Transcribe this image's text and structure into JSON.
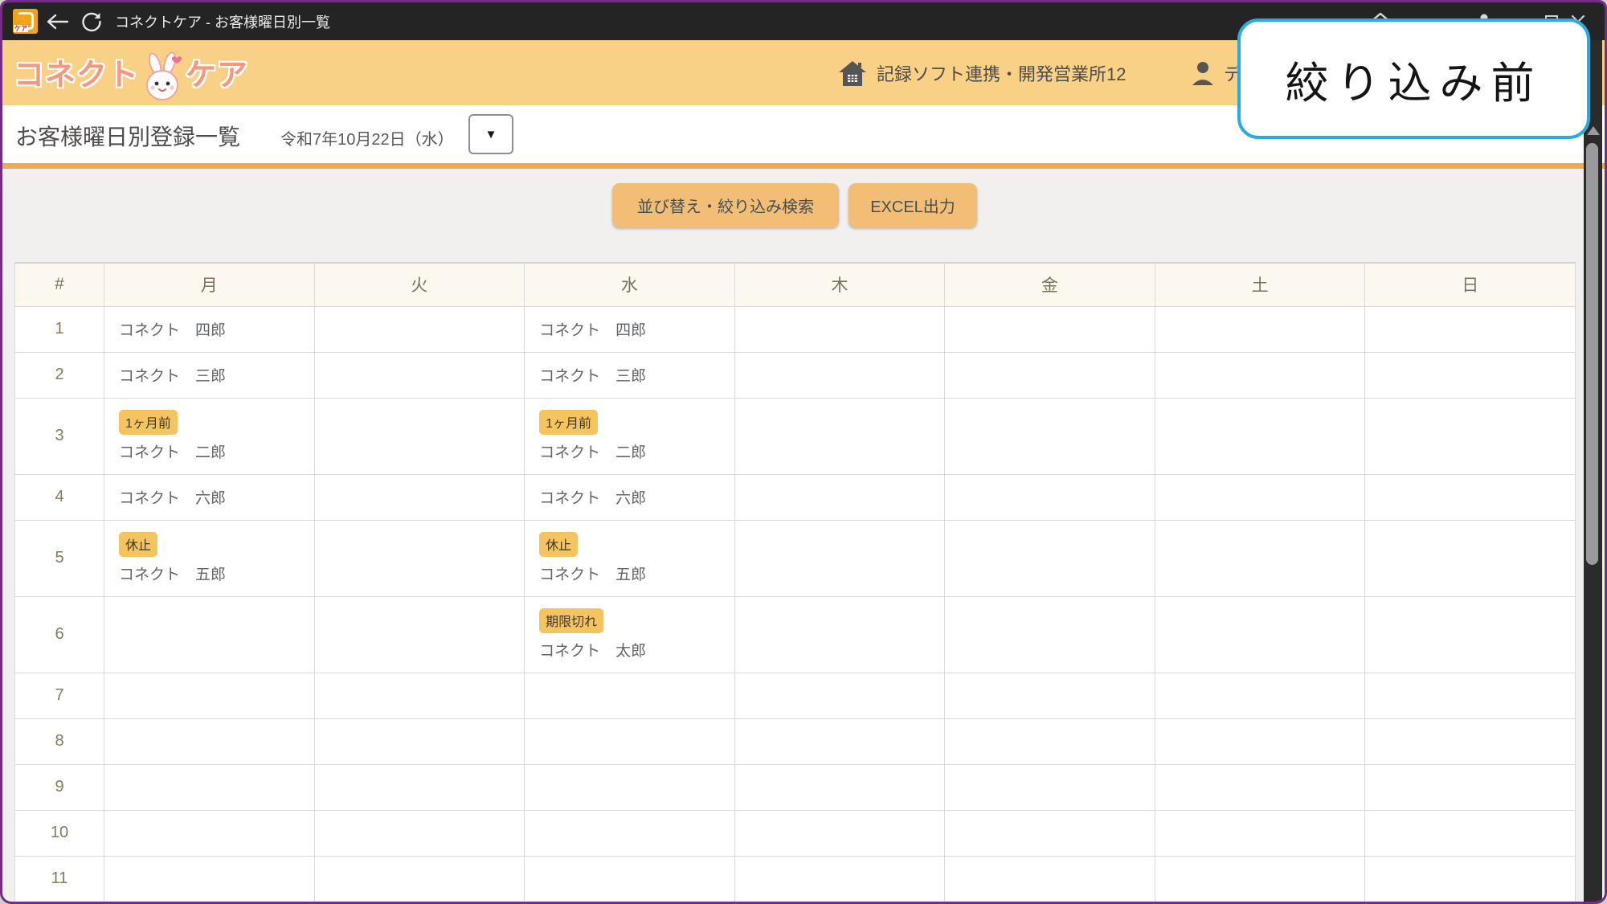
{
  "titlebar": {
    "title": "コネクトケア - お客様曜日別一覧",
    "icons": [
      "app-favicon",
      "back-icon",
      "refresh-icon",
      "home-icon",
      "profile-icon",
      "maximize-icon",
      "close-icon"
    ],
    "favicon_label": "ケア"
  },
  "header": {
    "logo_part1": "コネクト",
    "logo_part2": "ケア",
    "office": "記録ソフト連携・開発営業所12",
    "user_fragment": "デ"
  },
  "page": {
    "title": "お客様曜日別登録一覧",
    "date": "令和7年10月22日（水）",
    "date_dropdown_caret": "▼"
  },
  "toolbar": {
    "sort_filter_label": "並び替え・絞り込み検索",
    "excel_label": "EXCEL出力"
  },
  "table": {
    "columns": [
      "#",
      "月",
      "火",
      "水",
      "木",
      "金",
      "土",
      "日"
    ],
    "rows": [
      {
        "num": "1",
        "days": [
          {
            "name": "コネクト　四郎"
          },
          null,
          {
            "name": "コネクト　四郎"
          },
          null,
          null,
          null,
          null
        ]
      },
      {
        "num": "2",
        "days": [
          {
            "name": "コネクト　三郎"
          },
          null,
          {
            "name": "コネクト　三郎"
          },
          null,
          null,
          null,
          null
        ]
      },
      {
        "num": "3",
        "days": [
          {
            "badge": "1ヶ月前",
            "name": "コネクト　二郎"
          },
          null,
          {
            "badge": "1ヶ月前",
            "name": "コネクト　二郎"
          },
          null,
          null,
          null,
          null
        ]
      },
      {
        "num": "4",
        "days": [
          {
            "name": "コネクト　六郎"
          },
          null,
          {
            "name": "コネクト　六郎"
          },
          null,
          null,
          null,
          null
        ]
      },
      {
        "num": "5",
        "days": [
          {
            "badge": "休止",
            "name": "コネクト　五郎"
          },
          null,
          {
            "badge": "休止",
            "name": "コネクト　五郎"
          },
          null,
          null,
          null,
          null
        ]
      },
      {
        "num": "6",
        "days": [
          null,
          null,
          {
            "badge": "期限切れ",
            "name": "コネクト　太郎"
          },
          null,
          null,
          null,
          null
        ]
      },
      {
        "num": "7",
        "days": [
          null,
          null,
          null,
          null,
          null,
          null,
          null
        ]
      },
      {
        "num": "8",
        "days": [
          null,
          null,
          null,
          null,
          null,
          null,
          null
        ]
      },
      {
        "num": "9",
        "days": [
          null,
          null,
          null,
          null,
          null,
          null,
          null
        ]
      },
      {
        "num": "10",
        "days": [
          null,
          null,
          null,
          null,
          null,
          null,
          null
        ]
      },
      {
        "num": "11",
        "days": [
          null,
          null,
          null,
          null,
          null,
          null,
          null
        ]
      }
    ]
  },
  "callout": {
    "text": "絞り込み前"
  },
  "colors": {
    "window_border": "#742d86",
    "titlebar_bg": "#242424",
    "header_bg": "#f9d186",
    "accent_orange": "#f0a851",
    "button_bg": "#f2bd74",
    "badge_bg": "#f6c45e",
    "table_header_bg": "#fcf7ef",
    "callout_border": "#29abe2"
  }
}
